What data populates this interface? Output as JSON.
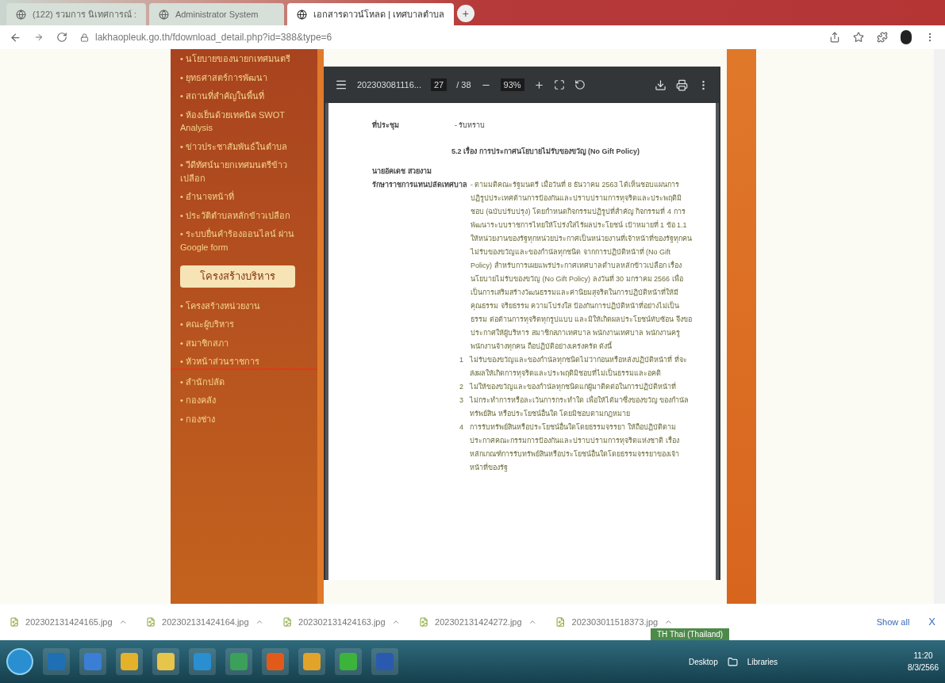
{
  "browser": {
    "tabs": [
      {
        "title": "(122) รวมการ นิเทศการณ์ :",
        "selected": false
      },
      {
        "title": "Administrator System",
        "selected": false
      },
      {
        "title": "เอกสารดาวน์โหลด | เทศบาลตำบล",
        "selected": true
      }
    ],
    "new_tab": "+",
    "url": "lakhaopleuk.go.th/fdownload_detail.php?id=388&type=6"
  },
  "sidebar": {
    "bullet": "•",
    "items": [
      "นโยบายของนายกเทศมนตรี",
      "ยุทธศาสตร์การพัฒนา",
      "สถานที่สำคัญในพื้นที่",
      "ห้องเย็นด้วยเทคนิค SWOT Analysis",
      "ข่าวประชาสัมพันธ์ในตำบล",
      "วีดีทัศน์นายกเทศมนตรีข้าวเปลือก",
      "อำนาจหน้าที่",
      "ประวัติตำบลหลักข้าวเปลือก",
      "ระบบยื่นคำร้องออนไลน์ ผ่าน Google form"
    ],
    "section_button": "โครงสร้างบริหาร",
    "section_items": [
      {
        "label": "โครงสร้างหน่วยงาน",
        "selected": false
      },
      {
        "label": "คณะผู้บริหาร",
        "selected": false
      },
      {
        "label": "สมาชิกสภา",
        "selected": false
      },
      {
        "label": "หัวหน้าส่วนราชการ",
        "selected": true
      },
      {
        "label": "สำนักปลัด",
        "selected": false
      },
      {
        "label": "กองคลัง",
        "selected": false
      },
      {
        "label": "กองช่าง",
        "selected": false
      }
    ]
  },
  "pdf_viewer": {
    "file_name": "202303081116...",
    "page": "27",
    "pages": "/ 38",
    "zoom": "93%",
    "document": {
      "meeting_label": "ที่ประชุม",
      "meeting_value": "- รับทราบ",
      "heading": "5.2 เรื่อง การประกาศนโยบายไม่รับของขวัญ (No Gift Policy)",
      "speaker": "นายอัคเดช สวยงาม",
      "speaker_role": "รักษาราชการแทนปลัดเทศบาล",
      "paragraph": "- ตามมติคณะรัฐมนตรี เมื่อวันที่ 8 ธันวาคม 2563 ได้เห็นชอบแผนการปฏิรูปประเทศด้านการป้องกันและปราบปรามการทุจริตและประพฤติมิชอบ (ฉบับปรับปรุง) โดยกำหนดกิจกรรมปฏิรูปที่สำคัญ กิจกรรมที่ 4 การพัฒนาระบบราชการไทยให้โปร่งใสไร้ผลประโยชน์ เป้าหมายที่ 1 ข้อ 1.1 ให้หน่วยงานของรัฐทุกหน่วยประกาศเป็นหน่วยงานที่เจ้าหน้าที่ของรัฐทุกคนไม่รับของขวัญและของกำนัลทุกชนิด จากการปฏิบัติหน้าที่ (No Gift Policy) สำหรับการเผยแพร่ประกาศเทศบาลตำบลหลักข้าวเปลือก เรื่อง นโยบายไม่รับของขวัญ (No Gift Policy) ลงวันที่ 30 มกราคม 2566 เพื่อเป็นการเสริมสร้างวัฒนธรรมและค่านิยมสุจริตในการปฏิบัติหน้าที่ให้มีคุณธรรม จริยธรรม ความโปร่งใส ป้องกันการปฏิบัติหน้าที่อย่างไม่เป็นธรรม ต่อต้านการทุจริตทุกรูปแบบ และมิให้เกิดผลประโยชน์ทับซ้อน จึงขอประกาศให้ผู้บริหาร สมาชิกสภาเทศบาล พนักงานเทศบาล พนักงานครู พนักงานจ้างทุกคน ถือปฏิบัติอย่างเคร่งครัด ดังนี้",
      "points": [
        {
          "number": "1",
          "text": "ไม่รับของขวัญและของกำนัลทุกชนิดไม่ว่าก่อนหรือหลังปฏิบัติหน้าที่ ที่จะส่งผลให้เกิดการทุจริตและประพฤติมิชอบที่ไม่เป็นธรรมและอคติ"
        },
        {
          "number": "2",
          "text": "ไม่ให้ของขวัญและของกำนัลทุกชนิดแก่ผู้มาติดต่อในการปฏิบัติหน้าที่"
        },
        {
          "number": "3",
          "text": "ไม่กระทำการหรือละเว้นการกระทำใด เพื่อให้ได้มาซึ่งของขวัญ ของกำนัล ทรัพย์สิน หรือประโยชน์อื่นใด โดยมิชอบตามกฎหมาย"
        },
        {
          "number": "4",
          "text": "การรับทรัพย์สินหรือประโยชน์อื่นใดโดยธรรมจรรยา ให้ถือปฏิบัติตามประกาศคณะกรรมการป้องกันและปราบปรามการทุจริตแห่งชาติ เรื่อง หลักเกณฑ์การรับทรัพย์สินหรือประโยชน์อื่นใดโดยธรรมจรรยาของเจ้าหน้าที่ของรัฐ"
        }
      ]
    }
  },
  "downloads": {
    "files": [
      "202302131424165.jpg",
      "202302131424164.jpg",
      "202302131424163.jpg",
      "202302131424272.jpg",
      "202303011518373.jpg"
    ],
    "show_all": "Show all",
    "close": "X"
  },
  "language_popup": "TH Thai (Thailand)",
  "taskbar": {
    "desktop": "Desktop",
    "libraries": "Libraries",
    "time": "11:20",
    "date": "8/3/2566"
  }
}
